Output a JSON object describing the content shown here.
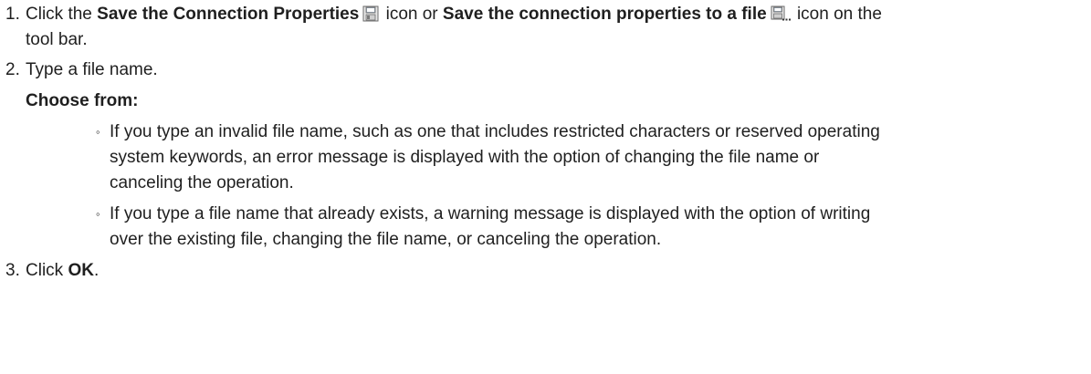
{
  "steps": [
    {
      "number": "1.",
      "text_before": "Click the ",
      "bold_1": "Save the Connection Properties",
      "text_mid": " icon or ",
      "bold_2": "Save the connection properties to a file",
      "text_after": " icon on the",
      "continuation": "tool bar.",
      "icon_1": "floppy-disk-save-icon",
      "icon_2": "floppy-disk-save-to-file-icon"
    },
    {
      "number": "2.",
      "text": "Type a file name.",
      "choose_label": "Choose from:",
      "choices": [
        {
          "lines": [
            "If you type an invalid file name, such as one that includes restricted characters or reserved operating",
            "system keywords, an error message is displayed with the option of changing the file name or",
            "canceling the operation."
          ]
        },
        {
          "lines": [
            "If you type a file name that already exists, a warning message is displayed with the option of writing",
            "over the existing file, changing the file name, or canceling the operation."
          ]
        }
      ]
    },
    {
      "number": "3.",
      "text_before": "Click ",
      "bold": "OK",
      "text_after": "."
    }
  ]
}
